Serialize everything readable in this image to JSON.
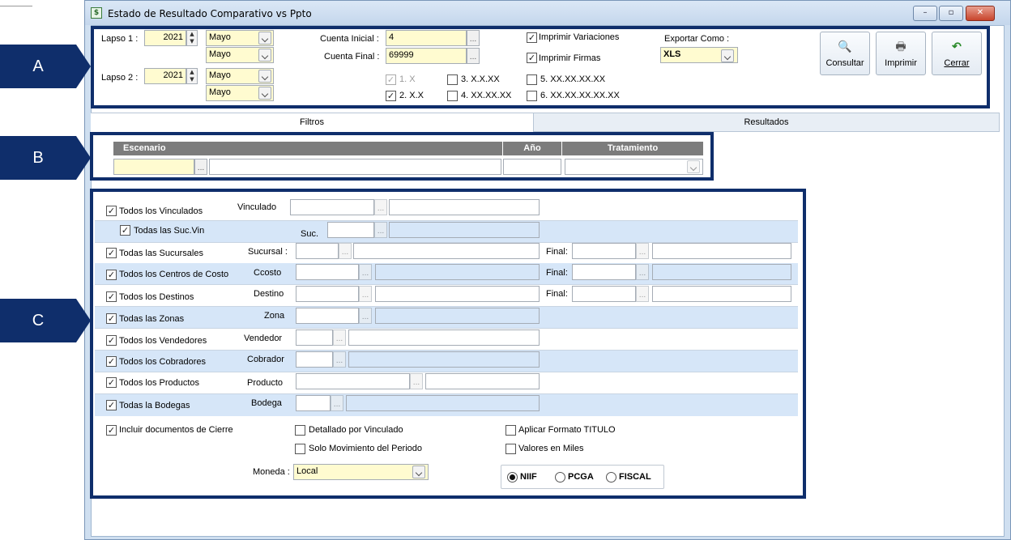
{
  "window": {
    "title": "Estado de Resultado Comparativo vs Ppto",
    "app_icon_glyph": "$"
  },
  "callouts": {
    "a": "A",
    "b": "B",
    "c": "C"
  },
  "header": {
    "lapso1_label": "Lapso 1 :",
    "lapso1_year": "2021",
    "lapso1_month1": "Mayo",
    "lapso1_month2": "Mayo",
    "lapso2_label": "Lapso 2 :",
    "lapso2_year": "2021",
    "lapso2_month1": "Mayo",
    "lapso2_month2": "Mayo",
    "cuenta_inicial_label": "Cuenta Inicial :",
    "cuenta_inicial": "4",
    "cuenta_final_label": "Cuenta Final :",
    "cuenta_final": "69999",
    "imprimir_variaciones": "Imprimir Variaciones",
    "imprimir_firmas": "Imprimir Firmas",
    "exportar_label": "Exportar Como :",
    "exportar_value": "XLS",
    "levels": [
      "1. X",
      "2. X.X",
      "3. X.X.XX",
      "4. XX.XX.XX",
      "5. XX.XX.XX.XX",
      "6. XX.XX.XX.XX.XX"
    ],
    "consultar": "Consultar",
    "imprimir": "Imprimir",
    "cerrar": "Cerrar"
  },
  "tabs": {
    "filtros": "Filtros",
    "resultados": "Resultados"
  },
  "escenario": {
    "col_escenario": "Escenario",
    "col_anio": "Año",
    "col_tratamiento": "Tratamiento"
  },
  "filters": [
    {
      "check": "Todos los Vinculados",
      "label": "Vinculado"
    },
    {
      "check": "Todas las Suc.Vin",
      "label": "Suc."
    },
    {
      "check": "Todas las Sucursales",
      "label": "Sucursal :",
      "final": "Final:"
    },
    {
      "check": "Todos los Centros de Costo",
      "label": "Ccosto",
      "final": "Final:"
    },
    {
      "check": "Todos los Destinos",
      "label": "Destino",
      "final": "Final:"
    },
    {
      "check": "Todas las Zonas",
      "label": "Zona"
    },
    {
      "check": "Todos los Vendedores",
      "label": "Vendedor"
    },
    {
      "check": "Todos los Cobradores",
      "label": "Cobrador"
    },
    {
      "check": "Todos los Productos",
      "label": "Producto"
    },
    {
      "check": "Todas la Bodegas",
      "label": "Bodega"
    }
  ],
  "options": {
    "incluir_cierre": "Incluir documentos de Cierre",
    "detallado_vinculado": "Detallado por Vinculado",
    "aplicar_titulo": "Aplicar Formato TITULO",
    "solo_movimiento": "Solo Movimiento del Periodo",
    "valores_miles": "Valores en Miles",
    "moneda_label": "Moneda :",
    "moneda_value": "Local",
    "niif": "NIIF",
    "pcga": "PCGA",
    "fiscal": "FISCAL"
  },
  "colors": {
    "callout": "#0f2e6b",
    "row_blue": "#d6e6f8",
    "input_yellow": "#fffbd0",
    "header_gray": "#7c7c7c"
  }
}
